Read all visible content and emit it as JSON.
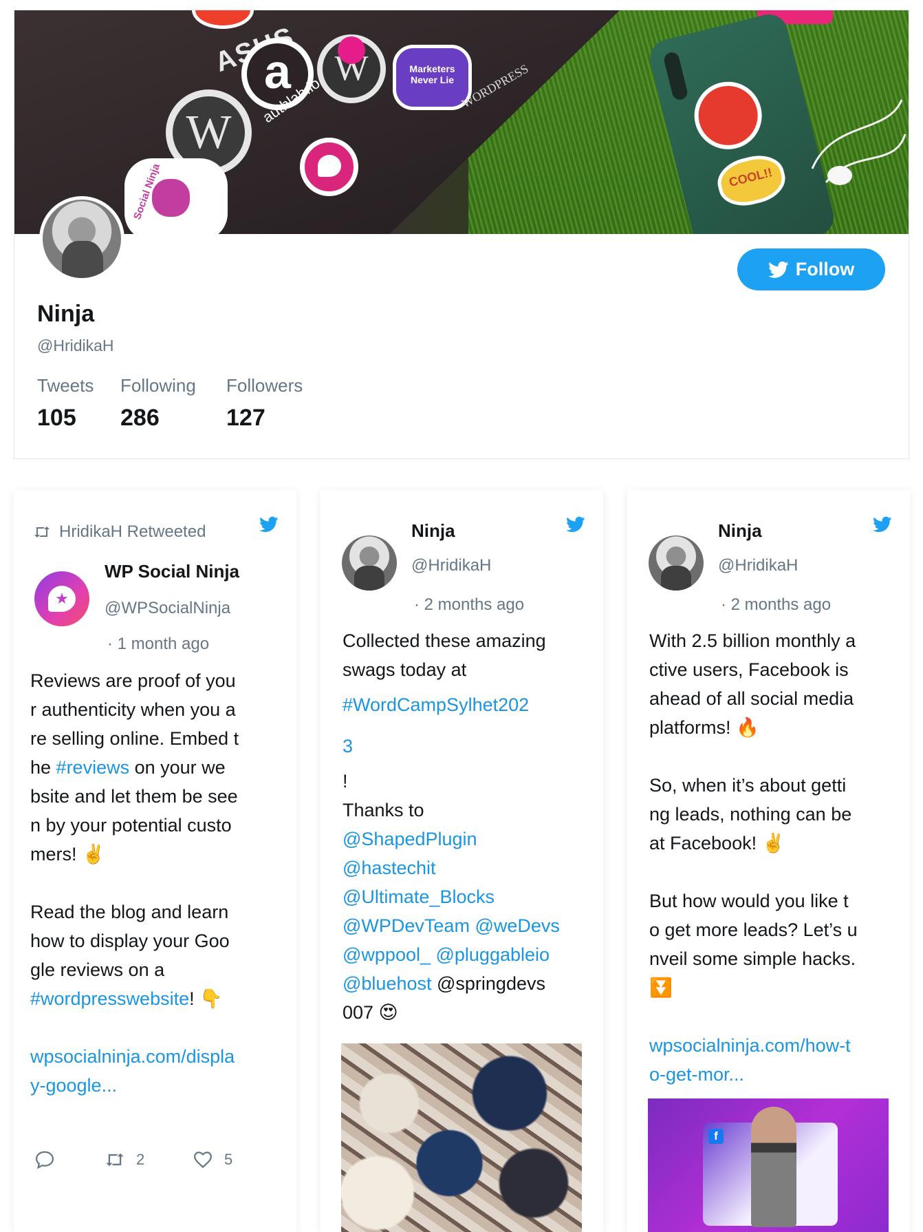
{
  "profile": {
    "name": "Ninja",
    "handle": "@HridikaH",
    "follow_label": "Follow",
    "stats": [
      {
        "label": "Tweets",
        "value": "105"
      },
      {
        "label": "Following",
        "value": "286"
      },
      {
        "label": "Followers",
        "value": "127"
      }
    ]
  },
  "cover_text": {
    "asus": "ASUS",
    "authlab": "authlab.io",
    "marketers": "Marketers Never Lie",
    "wordpress": "WORDPRESS",
    "cool": "COOL!!",
    "social_ninja": "Social Ninja"
  },
  "tweets": [
    {
      "retweet_label": "HridikaH Retweeted",
      "name": "WP Social Ninja",
      "handle": "@WPSocialNinja",
      "time": "· 1 month ago",
      "text_parts": {
        "p1": "Reviews are proof of you\nr authenticity when you a\nre selling online. Embed t\nhe ",
        "tag1": "#reviews",
        "p2": " on your we\nbsite and let them be see\nn by your potential custo\nmers! ✌️\n\nRead the blog and learn\nhow to display your Goo\ngle reviews on a\n",
        "tag2": "#wordpresswebsite",
        "p3": "! 👇\n\n",
        "link": "wpsocialninja.com/displa\ny-google..."
      },
      "retweets": "2",
      "likes": "5"
    },
    {
      "name": "Ninja",
      "handle": "@HridikaH",
      "time": "· 2 months ago",
      "text_parts": {
        "p1": "Collected these amazing\nswags today at\n",
        "tag1": "#WordCampSylhet202\n3",
        "p2": "\n!\nThanks to\n",
        "mentions": "@ShapedPlugin\n@hastechit\n@Ultimate_Blocks\n@WPDevTeam @weDevs\n@wppool_ @pluggableio\n@bluehost",
        "p3": " @springdevs\n007 😍"
      }
    },
    {
      "name": "Ninja",
      "handle": "@HridikaH",
      "time": "· 2 months ago",
      "text_parts": {
        "p1": "With 2.5 billion monthly a\nctive users, Facebook is\nahead of all social media\nplatforms! 🔥\n\nSo, when it’s about getti\nng leads, nothing can be\nat Facebook! ✌️\n\nBut how would you like t\no get more leads? Let’s u\nnveil some simple hacks.\n⏬\n\n",
        "link": "wpsocialninja.com/how-t\no-get-mor..."
      }
    }
  ],
  "colors": {
    "twitter_blue": "#1da1f2",
    "link_blue": "#1b95e0",
    "muted_gray": "#657786"
  },
  "icons": [
    "twitter-bird-icon",
    "retweet-icon",
    "reply-icon",
    "like-icon",
    "facebook-icon"
  ]
}
